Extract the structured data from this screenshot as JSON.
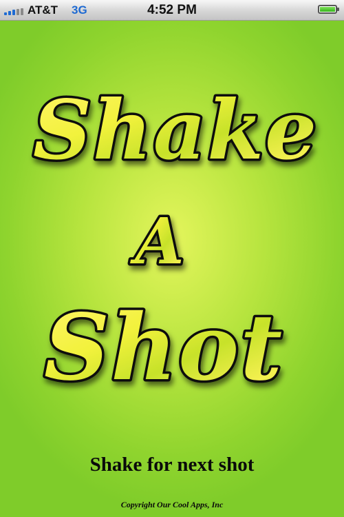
{
  "status_bar": {
    "carrier": "AT&T",
    "network": "3G",
    "time": "4:52 PM",
    "signal_bars": 3,
    "battery_level": 1.0,
    "accent_color": "#1e6ad2"
  },
  "app": {
    "logo": {
      "line1": "Shake",
      "line2": "A",
      "line3": "Shot",
      "fill_colors": [
        "#fff46a",
        "#e6ef2a",
        "#a8d41e"
      ]
    },
    "instruction": "Shake for next shot",
    "copyright": "Copyright Our Cool Apps, Inc",
    "background_colors": [
      "#e4f55c",
      "#7fcc2a"
    ]
  }
}
